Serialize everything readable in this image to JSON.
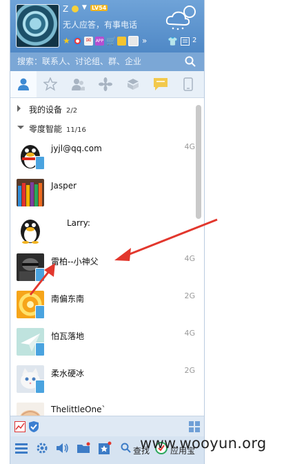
{
  "profile": {
    "nickname": "Z",
    "level_badge": "LV54",
    "status_message": "无人应答，有事电话",
    "weather_icon": "cloud-snow-icon",
    "notification_count": "2"
  },
  "search": {
    "placeholder": "搜索：联系人、讨论组、群、企业"
  },
  "tabs": [
    {
      "name": "contacts",
      "icon": "person-icon",
      "active": true
    },
    {
      "name": "favorites",
      "icon": "star-icon"
    },
    {
      "name": "groups",
      "icon": "group-icon"
    },
    {
      "name": "apps",
      "icon": "flower-icon"
    },
    {
      "name": "discover",
      "icon": "cube-icon"
    },
    {
      "name": "messages",
      "icon": "chat-icon"
    },
    {
      "name": "phone",
      "icon": "phone-icon"
    }
  ],
  "groups": [
    {
      "name": "我的设备",
      "count": "2/2",
      "expanded": false
    },
    {
      "name": "零度智能",
      "count": "11/16",
      "expanded": true
    }
  ],
  "contacts": [
    {
      "name": "jyjl@qq.com",
      "net": "4G",
      "avatar": "penguin",
      "mobile": true
    },
    {
      "name": "Jasper",
      "net": "",
      "avatar": "pencils",
      "mobile": false
    },
    {
      "name": "Larry:",
      "net": "",
      "avatar": "penguin",
      "mobile": false
    },
    {
      "name": "雷柏--小神父",
      "net": "4G",
      "avatar": "dark",
      "mobile": true
    },
    {
      "name": "南偏东南",
      "net": "2G",
      "avatar": "orange",
      "mobile": true
    },
    {
      "name": "怕瓦落地",
      "net": "4G",
      "avatar": "paper",
      "mobile": true
    },
    {
      "name": "柔水硬冰",
      "net": "2G",
      "avatar": "cat",
      "mobile": true
    },
    {
      "name": "ThelittleOne`",
      "net": "",
      "avatar": "hand",
      "mobile": false
    }
  ],
  "bottom": {
    "find_label": "查找",
    "app_label": "应用宝"
  },
  "watermark": "www.wooyun.org",
  "colors": {
    "header": "#5b93cf",
    "search_bar": "#7ba7d6",
    "arrow": "#e2372d"
  }
}
